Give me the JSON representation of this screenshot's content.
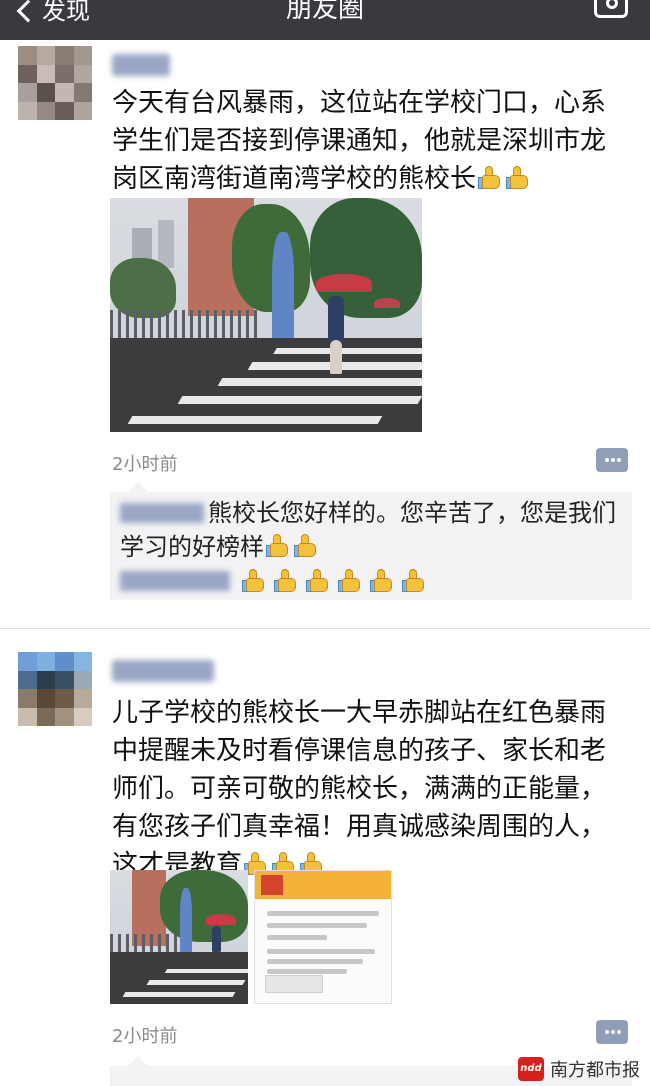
{
  "topbar": {
    "back_label": "发现",
    "title": "朋友圈"
  },
  "posts": [
    {
      "text": "今天有台风暴雨，这位站在学校门口，心系学生们是否接到停课通知，他就是深圳市龙岗区南湾街道南湾学校的熊校长",
      "time": "2小时前",
      "comments": [
        {
          "text": "熊校长您好样的。您辛苦了，您是我们学习的好榜样"
        }
      ]
    },
    {
      "text": "儿子学校的熊校长一大早赤脚站在红色暴雨中提醒未及时看停课信息的孩子、家长和老师们。可亲可敬的熊校长，满满的正能量，有您孩子们真幸福！用真诚感染周围的人，这才是教育",
      "time": "2小时前"
    }
  ],
  "watermark": {
    "logo": "ndd",
    "text": "南方都市报"
  },
  "colors": {
    "topbar": "#393a3f",
    "comment_bg": "#f3f3f5",
    "time_gray": "#8a8a8a",
    "thumbs_up": "#f2c23e",
    "brand_red": "#d6201c"
  },
  "icons": [
    "chevron-left-icon",
    "camera-icon",
    "thumbs-up-icon",
    "comment-icon"
  ]
}
